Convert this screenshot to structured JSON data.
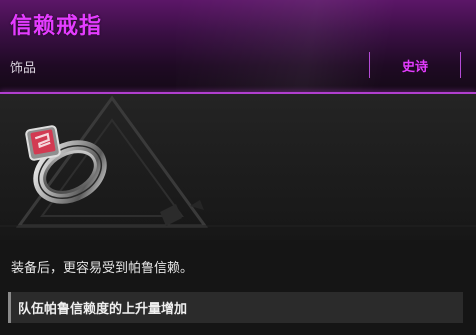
{
  "item": {
    "name": "信赖戒指",
    "category": "饰品",
    "rarity": "史诗",
    "description": "装备后，更容易受到帕鲁信赖。",
    "effect": "队伍帕鲁信赖度的上升量增加"
  },
  "icons": {
    "item_image": "ring-icon",
    "background": "triangle-emblem"
  },
  "colors": {
    "rarity_epic": "#e43cff",
    "header_purple": "#5c1668",
    "gem_red": "#d23a52"
  }
}
